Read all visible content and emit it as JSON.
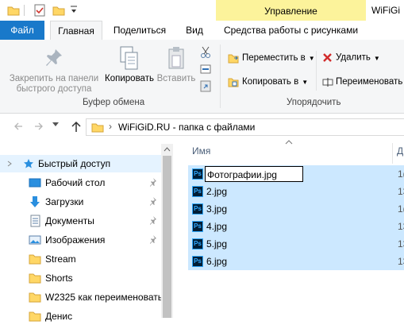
{
  "window": {
    "title": "WiFiGi",
    "context_group": "Управление"
  },
  "tabs": [
    {
      "label": "Файл"
    },
    {
      "label": "Главная"
    },
    {
      "label": "Поделиться"
    },
    {
      "label": "Вид"
    },
    {
      "label": "Средства работы с рисунками"
    }
  ],
  "ribbon": {
    "clipboard": {
      "pin_label_line1": "Закрепить на панели",
      "pin_label_line2": "быстрого доступа",
      "copy_label": "Копировать",
      "paste_label": "Вставить",
      "group_label": "Буфер обмена"
    },
    "organize": {
      "move_label": "Переместить в",
      "copy_to_label": "Копировать в",
      "delete_label": "Удалить",
      "rename_label": "Переименовать",
      "group_label": "Упорядочить"
    }
  },
  "address": {
    "path": "WiFiGiD.RU - папка с файлами"
  },
  "nav": {
    "items": [
      {
        "label": "Быстрый доступ",
        "icon": "star-icon"
      },
      {
        "label": "Рабочий стол",
        "icon": "desktop-icon"
      },
      {
        "label": "Загрузки",
        "icon": "download-icon"
      },
      {
        "label": "Документы",
        "icon": "documents-icon"
      },
      {
        "label": "Изображения",
        "icon": "pictures-icon"
      },
      {
        "label": "Stream",
        "icon": "folder-icon"
      },
      {
        "label": "Shorts",
        "icon": "folder-icon"
      },
      {
        "label": "W2325 как переименовать",
        "icon": "folder-icon"
      },
      {
        "label": "Денис",
        "icon": "folder-icon"
      }
    ]
  },
  "content": {
    "column_name": "Имя",
    "column_next": "Д",
    "files": [
      {
        "name": "Фотографии.jpg",
        "trunc": "1("
      },
      {
        "name": "2.jpg",
        "trunc": "13"
      },
      {
        "name": "3.jpg",
        "trunc": "1("
      },
      {
        "name": "4.jpg",
        "trunc": "13"
      },
      {
        "name": "5.jpg",
        "trunc": "13"
      },
      {
        "name": "6.jpg",
        "trunc": "13"
      }
    ]
  },
  "colors": {
    "file_tab": "#1979ca",
    "context_header": "#fcf39b",
    "selection": "#cce8ff"
  }
}
